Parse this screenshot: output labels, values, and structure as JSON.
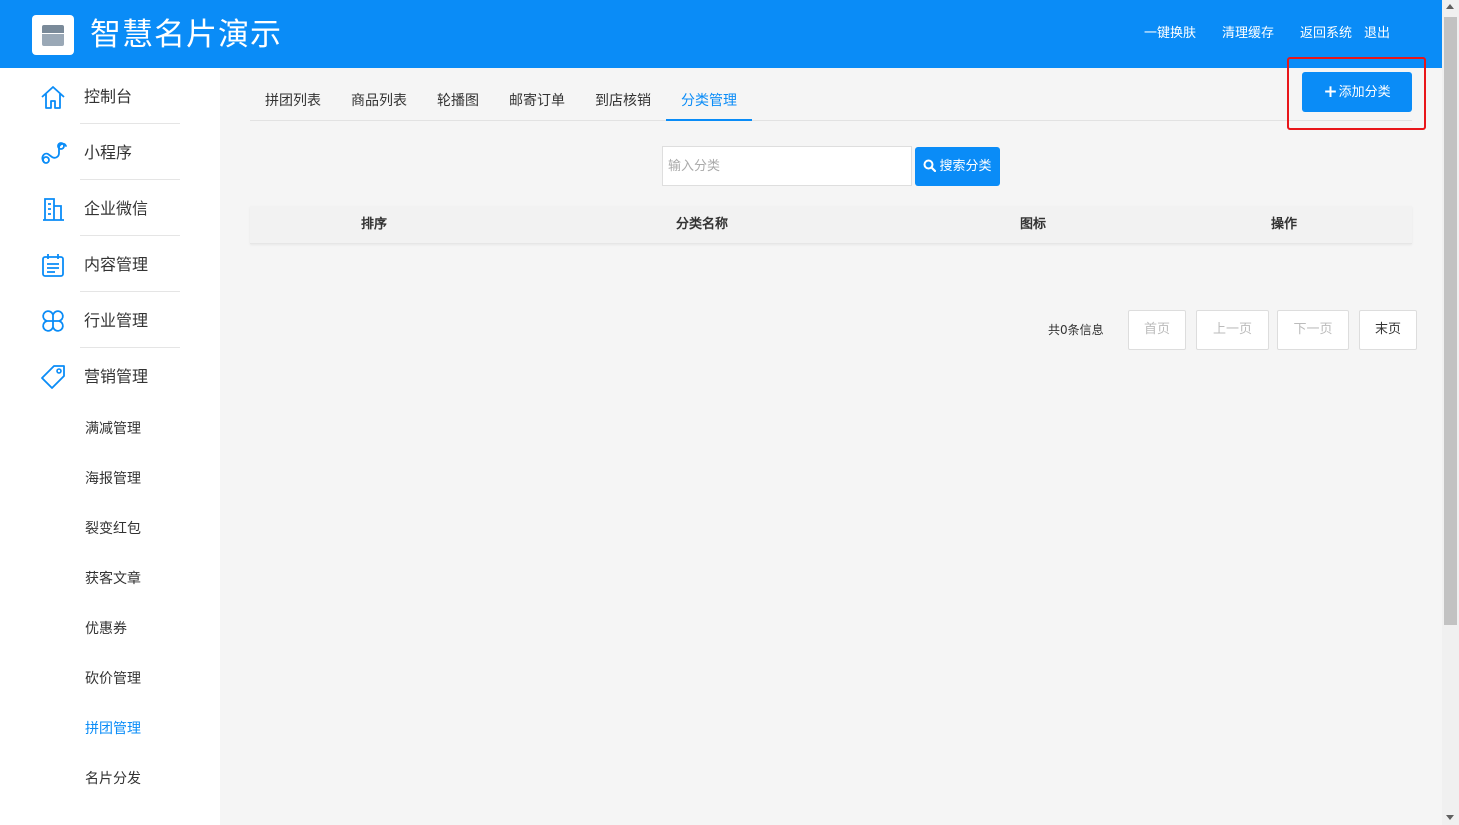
{
  "header": {
    "title": "智慧名片演示",
    "links": [
      "一键换肤",
      "清理缓存",
      "返回系统",
      "退出"
    ]
  },
  "sidebar": {
    "items": [
      {
        "label": "控制台",
        "icon": "home-icon"
      },
      {
        "label": "小程序",
        "icon": "miniprogram-icon"
      },
      {
        "label": "企业微信",
        "icon": "building-icon"
      },
      {
        "label": "内容管理",
        "icon": "calendar-icon"
      },
      {
        "label": "行业管理",
        "icon": "clover-icon"
      },
      {
        "label": "营销管理",
        "icon": "tag-icon"
      }
    ],
    "sub_items": [
      "满减管理",
      "海报管理",
      "裂变红包",
      "获客文章",
      "优惠券",
      "砍价管理",
      "拼团管理",
      "名片分发"
    ],
    "active_sub": "拼团管理"
  },
  "tabs": [
    "拼团列表",
    "商品列表",
    "轮播图",
    "邮寄订单",
    "到店核销",
    "分类管理"
  ],
  "active_tab": "分类管理",
  "add_button": {
    "label": "添加分类"
  },
  "search": {
    "placeholder": "输入分类",
    "button_label": "搜索分类"
  },
  "table": {
    "columns": [
      "排序",
      "分类名称",
      "图标",
      "操作"
    ],
    "rows": []
  },
  "pagination": {
    "total_text": "共0条信息",
    "buttons": [
      "首页",
      "上一页",
      "下一页",
      "末页"
    ]
  },
  "colors": {
    "primary": "#0a8cf7",
    "highlight": "#e8161a"
  }
}
